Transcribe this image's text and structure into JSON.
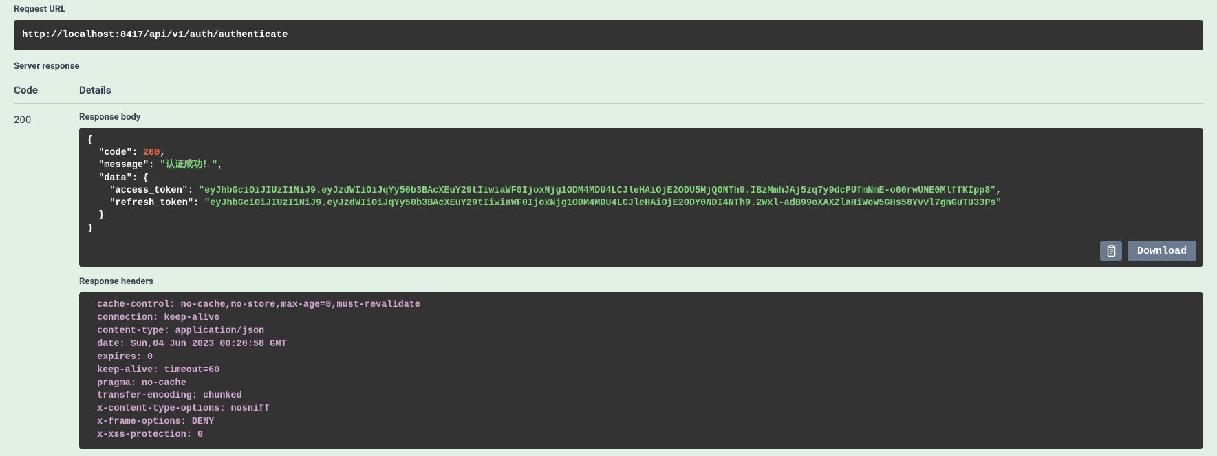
{
  "request_url_label": "Request URL",
  "request_url": "http://localhost:8417/api/v1/auth/authenticate",
  "server_response_label": "Server response",
  "columns": {
    "code": "Code",
    "details": "Details"
  },
  "status_code": "200",
  "response_body_label": "Response body",
  "response_body": {
    "open": "{",
    "l1_key": "\"code\"",
    "l1_colon": ": ",
    "l1_val": "200",
    "l1_comma": ",",
    "l2_key": "\"message\"",
    "l2_colon": ": ",
    "l2_val": "\"认证成功！\"",
    "l2_comma": ",",
    "l3_key": "\"data\"",
    "l3_colon": ": {",
    "l4_key": "\"access_token\"",
    "l4_colon": ": ",
    "l4_val": "\"eyJhbGciOiJIUzI1NiJ9.eyJzdWIiOiJqYy50b3BAcXEuY29tIiwiaWF0IjoxNjg1ODM4MDU4LCJleHAiOjE2ODU5MjQ0NTh9.IBzMmhJAj5zq7y9dcPUfmNmE-o60rwUNE0MlffKIpp8\"",
    "l4_comma": ",",
    "l5_key": "\"refresh_token\"",
    "l5_colon": ": ",
    "l5_val": "\"eyJhbGciOiJIUzI1NiJ9.eyJzdWIiOiJqYy50b3BAcXEuY29tIiwiaWF0IjoxNjg1ODM4MDU4LCJleHAiOjE2ODY0NDI4NTh9.2Wxl-adB99oXAXZlaHiWoW5GHs58Yvvl7gnGuTU33Ps\"",
    "l6": "  }",
    "close": "}"
  },
  "download_label": "Download",
  "response_headers_label": "Response headers",
  "headers": [
    {
      "k": " cache-control: ",
      "v": "no-cache,no-store,max-age=0,must-revalidate "
    },
    {
      "k": " connection: ",
      "v": "keep-alive "
    },
    {
      "k": " content-type: ",
      "v": "application/json "
    },
    {
      "k": " date: ",
      "v": "Sun,04 Jun 2023 00:20:58 GMT "
    },
    {
      "k": " expires: ",
      "v": "0 "
    },
    {
      "k": " keep-alive: ",
      "v": "timeout=60 "
    },
    {
      "k": " pragma: ",
      "v": "no-cache "
    },
    {
      "k": " transfer-encoding: ",
      "v": "chunked "
    },
    {
      "k": " x-content-type-options: ",
      "v": "nosniff "
    },
    {
      "k": " x-frame-options: ",
      "v": "DENY "
    },
    {
      "k": " x-xss-protection: ",
      "v": "0 "
    }
  ]
}
